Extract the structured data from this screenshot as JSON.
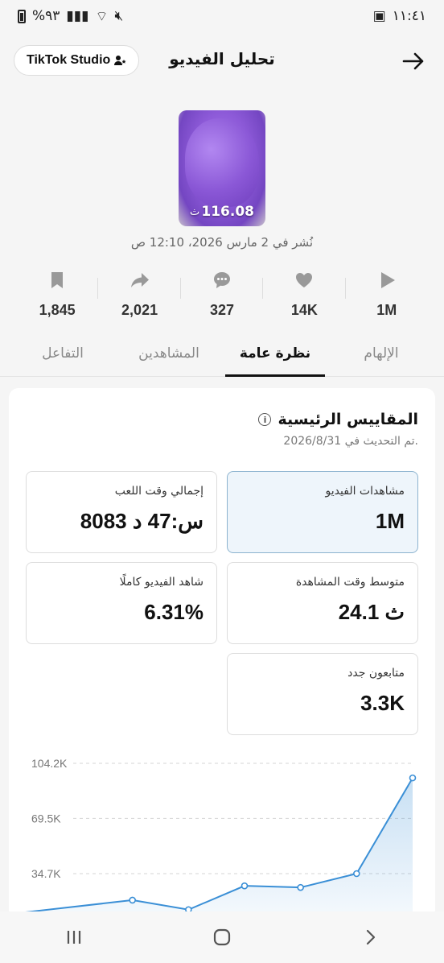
{
  "status_bar": {
    "time": "١١:٤١",
    "battery": "%٩٣"
  },
  "header": {
    "title": "تحليل الفيديو",
    "studio_button": "TikTok Studio"
  },
  "video": {
    "duration": "116.08",
    "duration_unit": "ث",
    "posted": "نُشر في 2 مارس 2026، 12:10 ص"
  },
  "stats": [
    {
      "icon": "play-icon",
      "value": "1M"
    },
    {
      "icon": "heart-icon",
      "value": "14K"
    },
    {
      "icon": "comment-icon",
      "value": "327"
    },
    {
      "icon": "share-icon",
      "value": "2,021"
    },
    {
      "icon": "bookmark-icon",
      "value": "1,845"
    }
  ],
  "tabs": [
    {
      "label": "الإلهام",
      "active": false
    },
    {
      "label": "نظرة عامة",
      "active": true
    },
    {
      "label": "المشاهدين",
      "active": false
    },
    {
      "label": "التفاعل",
      "active": false
    }
  ],
  "metrics": {
    "title": "المقاييس الرئيسية",
    "updated": "تم التحديث في 2026/8/31.",
    "items": [
      {
        "label": "مشاهدات الفيديو",
        "value": "1M"
      },
      {
        "label": "إجمالي وقت اللعب",
        "value": "8083 س:47 د"
      },
      {
        "label": "متوسط وقت المشاهدة",
        "value": "24.1 ث"
      },
      {
        "label": "شاهد الفيديو كاملًا",
        "value": "6.31%"
      },
      {
        "label": "متابعون جدد",
        "value": "3.3K"
      }
    ]
  },
  "chart_data": {
    "type": "area",
    "y_ticks": [
      "104.2K",
      "69.5K",
      "34.7K"
    ],
    "y_tick_values": [
      104200,
      69500,
      34700
    ],
    "ylim": [
      0,
      104200
    ],
    "x": [
      0,
      1,
      2,
      3,
      4,
      5,
      6
    ],
    "values": [
      10000,
      18000,
      12000,
      27000,
      26000,
      34700,
      95000
    ],
    "color": "#3a8fd6"
  }
}
